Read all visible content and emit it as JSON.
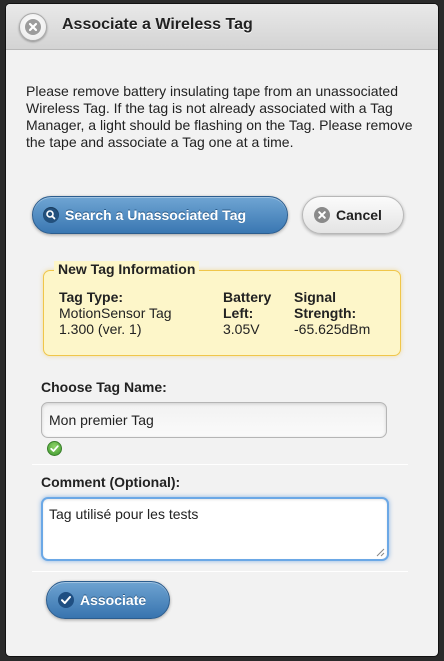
{
  "dialog": {
    "title": "Associate a Wireless Tag",
    "close_icon": "close-circle-icon"
  },
  "intro": {
    "text": "Please remove battery insulating tape from an unassociated Wireless Tag. If the tag is not already associated with a Tag Manager, a light should be flashing on the Tag. Please remove the tape and associate a Tag one at a time."
  },
  "actions": {
    "search_label": "Search a Unassociated Tag",
    "cancel_label": "Cancel"
  },
  "tag_info": {
    "legend": "New Tag Information",
    "type_header": "Tag Type:",
    "type_line1": "MotionSensor Tag",
    "type_line2": "1.300 (ver. 1)",
    "battery_header_1": "Battery",
    "battery_header_2": "Left:",
    "battery_value": "3.05V",
    "signal_header_1": "Signal",
    "signal_header_2": "Strength:",
    "signal_value": "-65.625dBm"
  },
  "form": {
    "name_label": "Choose Tag Name:",
    "name_value": "Mon premier Tag",
    "comment_label": "Comment (Optional):",
    "comment_value": "Tag utilisé pour les tests",
    "submit_label": "Associate"
  },
  "colors": {
    "primary_button": "#3a77b2",
    "info_background": "#fdf6c9",
    "info_border": "#f0c64a",
    "focus_ring": "#6ba8e6",
    "valid": "#3b962c"
  }
}
